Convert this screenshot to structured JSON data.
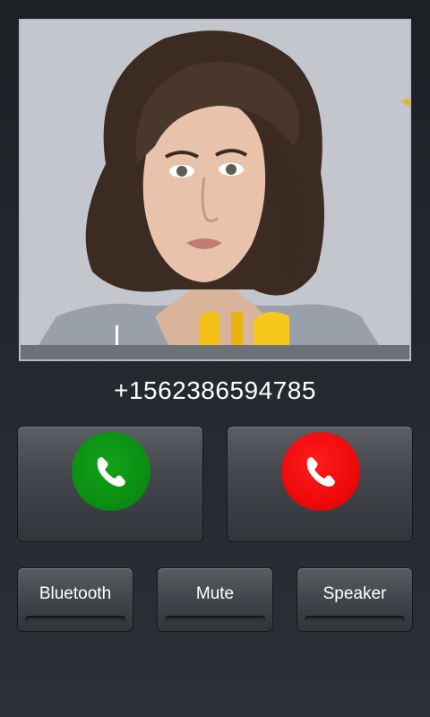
{
  "caller": {
    "number": "+1562386594785",
    "photo_description_icon": "caller-photo"
  },
  "actions": {
    "answer_icon": "phone-icon",
    "decline_icon": "phone-icon",
    "answer_color": "#0b8f12",
    "decline_color": "#ee0a0a"
  },
  "toggles": [
    {
      "label": "Bluetooth",
      "state": "off"
    },
    {
      "label": "Mute",
      "state": "off"
    },
    {
      "label": "Speaker",
      "state": "off"
    }
  ]
}
